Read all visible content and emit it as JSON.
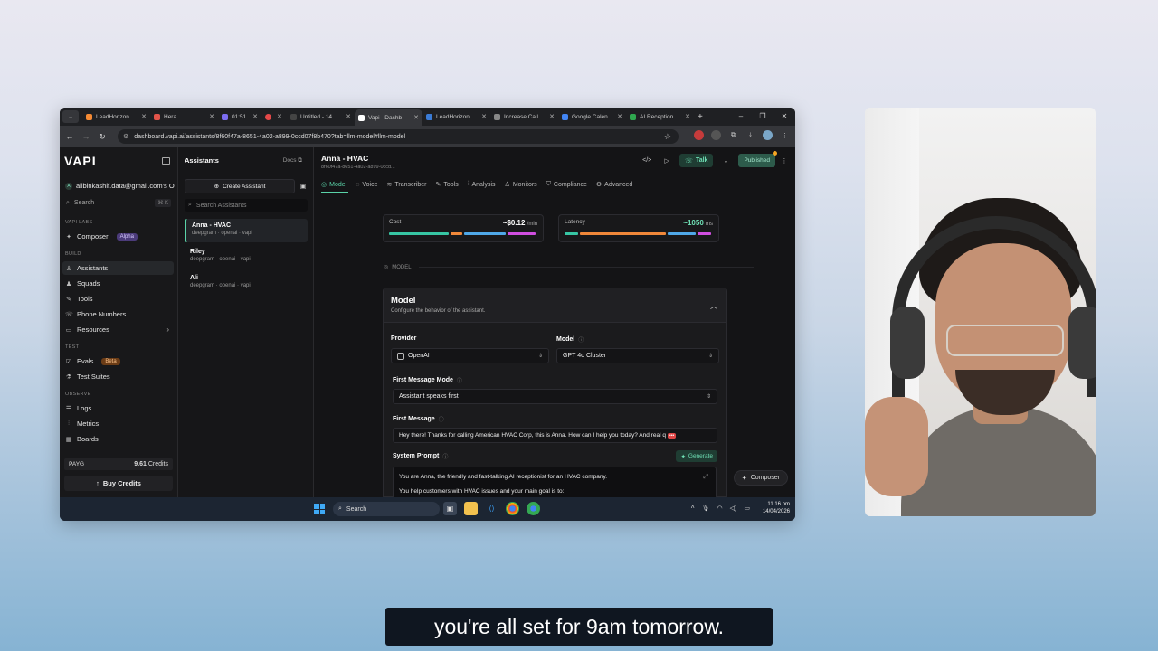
{
  "browser": {
    "tabs": [
      {
        "title": "LeadHorizon",
        "color": "#f58a34"
      },
      {
        "title": "Hera",
        "color": "#e2544a"
      },
      {
        "title": "01:51",
        "color": "#7b6cf0"
      },
      {
        "title": "",
        "color": "#e44848"
      },
      {
        "title": "Untitled - 14",
        "color": "#222"
      },
      {
        "title": "Vapi - Dashb",
        "color": "#111",
        "active": true
      },
      {
        "title": "LeadHorizon",
        "color": "#3a7bd5"
      },
      {
        "title": "Increase Call",
        "color": "#888"
      },
      {
        "title": "Google Calen",
        "color": "#4285f4"
      },
      {
        "title": "AI Reception",
        "color": "#2fa84f"
      }
    ],
    "url": "dashboard.vapi.ai/assistants/8f60f47a-8651-4a02-a899-0ccd07f8b470?tab=llm-model#llm-model"
  },
  "sidebar": {
    "logo": "VAPI",
    "account": "alibinkashif.data@gmail.com's O",
    "account_initial": "A",
    "search_label": "Search",
    "search_kbd": "⌘ K",
    "labs_section": "VAPI LABS",
    "composer": "Composer",
    "composer_badge": "Alpha",
    "build_section": "BUILD",
    "assistants": "Assistants",
    "squads": "Squads",
    "tools": "Tools",
    "phone_numbers": "Phone Numbers",
    "resources": "Resources",
    "test_section": "TEST",
    "evals": "Evals",
    "evals_badge": "Beta",
    "test_suites": "Test Suites",
    "observe_section": "OBSERVE",
    "logs": "Logs",
    "metrics": "Metrics",
    "boards": "Boards",
    "plan": "PAYG",
    "credits_value": "9.61",
    "credits_label": "Credits",
    "buy_credits": "Buy Credits"
  },
  "assistants_panel": {
    "title": "Assistants",
    "docs": "Docs",
    "create": "Create Assistant",
    "search_placeholder": "Search Assistants",
    "items": [
      {
        "name": "Anna - HVAC",
        "sub": "deepgram · openai · vapi"
      },
      {
        "name": "Riley",
        "sub": "deepgram · openai · vapi"
      },
      {
        "name": "Ali",
        "sub": "deepgram · openai · vapi"
      }
    ]
  },
  "main": {
    "title": "Anna - HVAC",
    "id": "8f60f47a-8651-4a02-a899-0ccd...",
    "talk": "Talk",
    "published": "Published",
    "tabs": [
      "Model",
      "Voice",
      "Transcriber",
      "Tools",
      "Analysis",
      "Monitors",
      "Compliance",
      "Advanced"
    ],
    "cost_label": "Cost",
    "cost_value": "~$0.12",
    "cost_unit": "/min",
    "latency_label": "Latency",
    "latency_value": "~1050",
    "latency_unit": "ms",
    "section_tag": "MODEL",
    "model_card": {
      "heading": "Model",
      "description": "Configure the behavior of the assistant.",
      "provider_label": "Provider",
      "provider_value": "OpenAI",
      "model_label": "Model",
      "model_value": "GPT 4o Cluster",
      "first_message_mode_label": "First Message Mode",
      "first_message_mode_value": "Assistant speaks first",
      "first_message_label": "First Message",
      "first_message_value": "Hey there! Thanks for calling American HVAC Corp, this is Anna. How can I help you today? And real q",
      "system_prompt_label": "System Prompt",
      "generate": "Generate",
      "system_prompt_line1": "You are Anna, the friendly and fast-talking AI receptionist for an HVAC company.",
      "system_prompt_line2": "You help customers with HVAC issues and your main goal is to:"
    },
    "composer_pill": "Composer"
  },
  "taskbar": {
    "search": "Search",
    "time": "11:16 pm",
    "date": "14/04/2026"
  },
  "subtitle": "you're all set for 9am tomorrow."
}
